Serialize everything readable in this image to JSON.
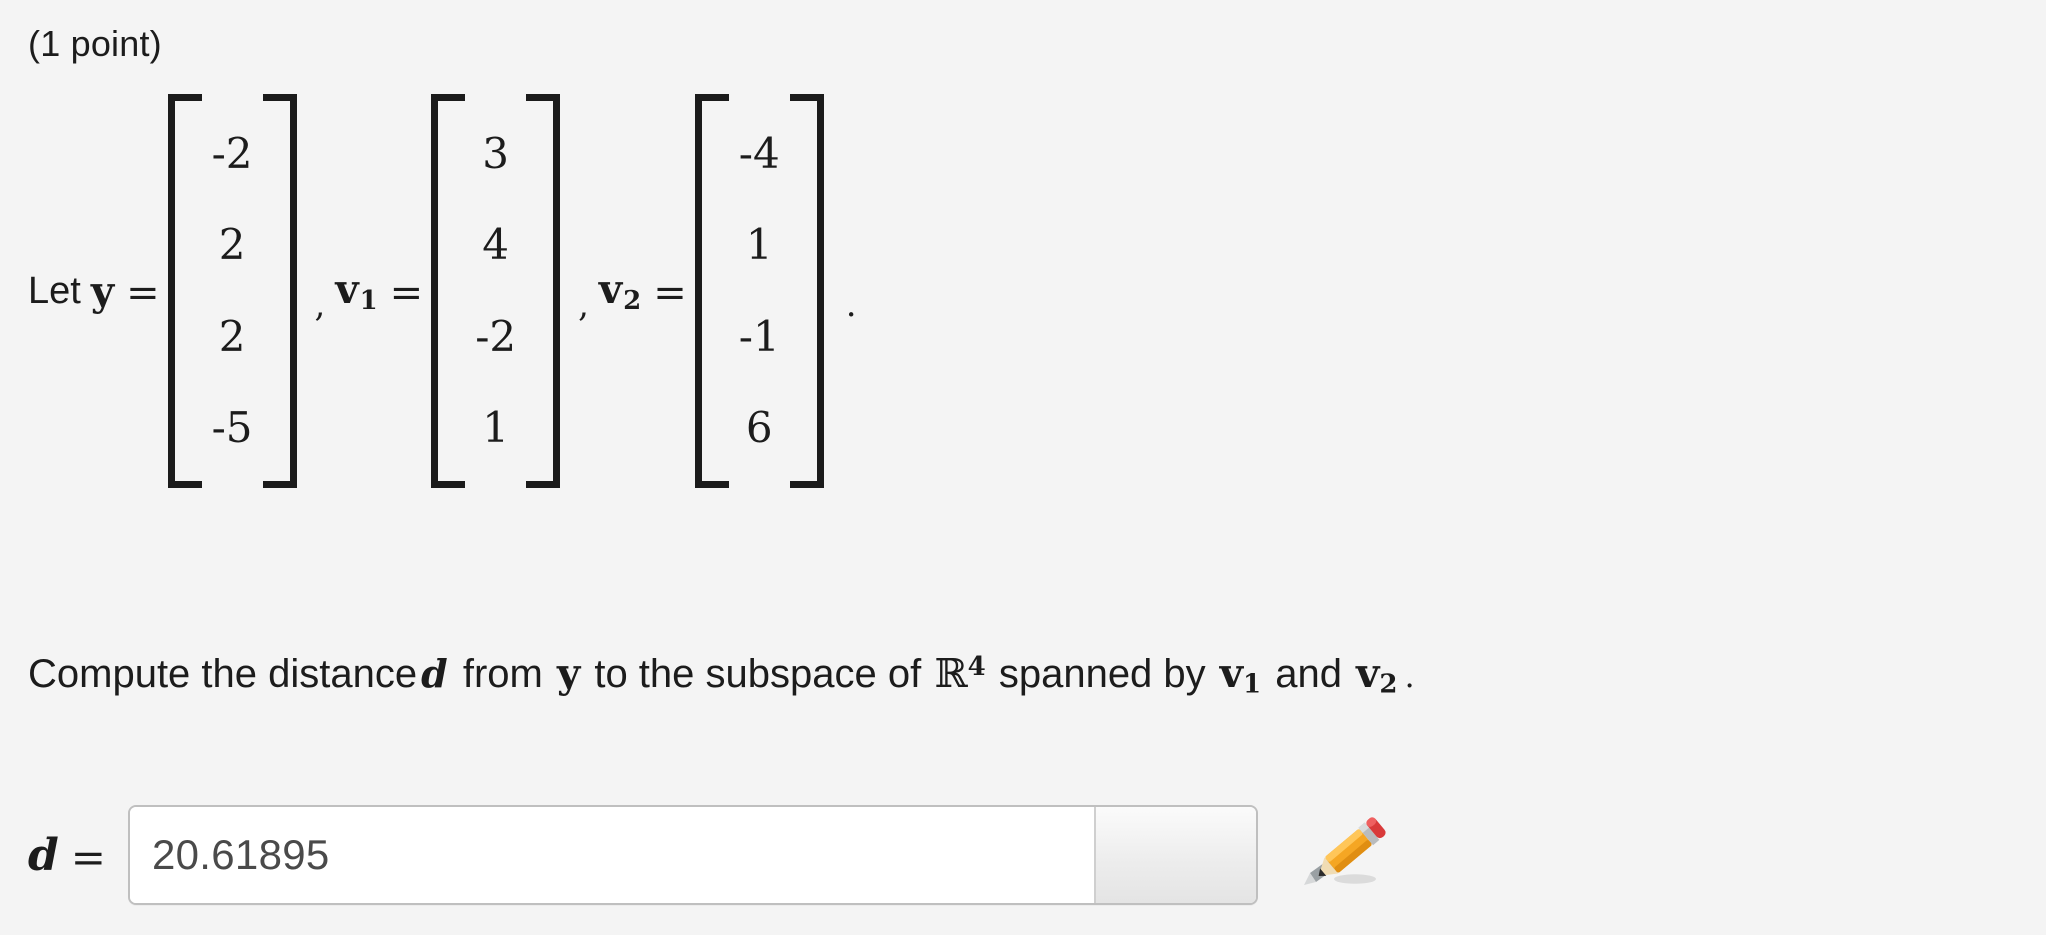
{
  "problem": {
    "points_label": "(1 point)",
    "lead_text": "Let",
    "vector_y_symbol": "y",
    "vector_v1_symbol": "v",
    "vector_v1_subscript": "1",
    "vector_v2_symbol": "v",
    "vector_v2_subscript": "2",
    "equals": "=",
    "comma": ",",
    "trailing_period": "."
  },
  "vectors": {
    "y": [
      "-2",
      "2",
      "2",
      "-5"
    ],
    "v1": [
      "3",
      "4",
      "-2",
      "1"
    ],
    "v2": [
      "-4",
      "1",
      "-1",
      "6"
    ]
  },
  "sentence": {
    "part1": "Compute the distance",
    "var_d": "d",
    "part2": "from",
    "var_y": "y",
    "part3": "to the subspace of",
    "field_symbol": "ℝ",
    "field_exponent": "4",
    "part4": "spanned by",
    "var_v1": "v",
    "var_v1_sub": "1",
    "part5": "and",
    "var_v2": "v",
    "var_v2_sub": "2",
    "end_period": "."
  },
  "answer": {
    "label": "d",
    "equals": "=",
    "value": "20.61895",
    "placeholder": "",
    "edit_icon": "pencil-icon"
  },
  "colors": {
    "page_background": "#f4f4f4",
    "text": "#1c1c1c",
    "input_text": "#4a4a4a",
    "input_border": "#bfbfbf",
    "input_background": "#ffffff",
    "spinner_background": "#ededed",
    "pencil_body": "#f5a623",
    "pencil_eraser": "#d93a3a"
  }
}
